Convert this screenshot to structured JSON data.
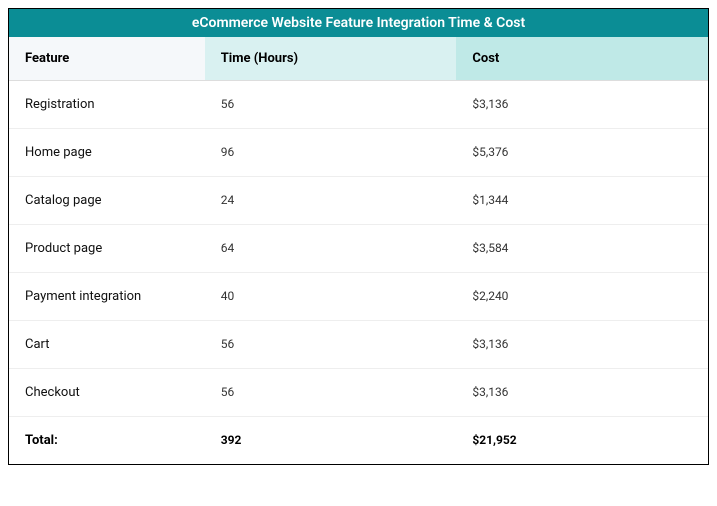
{
  "title": "eCommerce Website Feature Integration Time & Cost",
  "headers": {
    "feature": "Feature",
    "time": "Time (Hours)",
    "cost": "Cost"
  },
  "rows": [
    {
      "feature": "Registration",
      "time": "56",
      "cost": "$3,136"
    },
    {
      "feature": "Home page",
      "time": "96",
      "cost": "$5,376"
    },
    {
      "feature": "Catalog page",
      "time": "24",
      "cost": "$1,344"
    },
    {
      "feature": "Product page",
      "time": "64",
      "cost": "$3,584"
    },
    {
      "feature": "Payment integration",
      "time": "40",
      "cost": "$2,240"
    },
    {
      "feature": "Cart",
      "time": "56",
      "cost": "$3,136"
    },
    {
      "feature": "Checkout",
      "time": "56",
      "cost": "$3,136"
    }
  ],
  "total": {
    "label": "Total:",
    "time": "392",
    "cost": "$21,952"
  },
  "chart_data": {
    "type": "table",
    "title": "eCommerce Website Feature Integration Time & Cost",
    "columns": [
      "Feature",
      "Time (Hours)",
      "Cost"
    ],
    "rows": [
      [
        "Registration",
        56,
        3136
      ],
      [
        "Home page",
        96,
        5376
      ],
      [
        "Catalog page",
        24,
        1344
      ],
      [
        "Product page",
        64,
        3584
      ],
      [
        "Payment integration",
        40,
        2240
      ],
      [
        "Cart",
        56,
        3136
      ],
      [
        "Checkout",
        56,
        3136
      ]
    ],
    "totals": {
      "time": 392,
      "cost": 21952
    }
  }
}
